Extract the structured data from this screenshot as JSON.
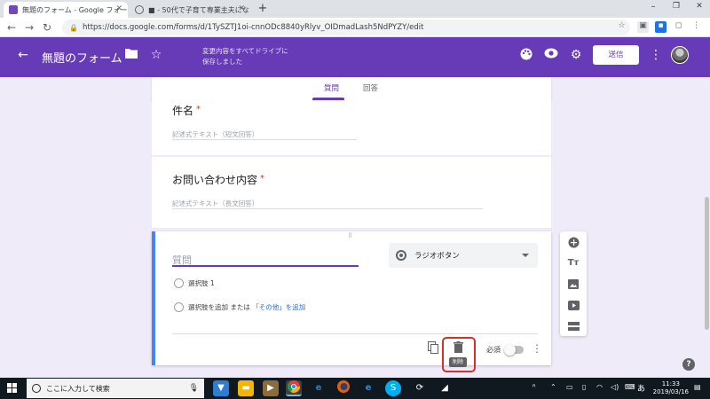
{
  "browser": {
    "tabs": [
      {
        "title": "無題のフォーム - Google フォーム",
        "active": true
      },
      {
        "title": "■ - 50代で子育て専業主夫になっ…",
        "active": false
      }
    ],
    "new_tab": "+",
    "url": "https://docs.google.com/forms/d/1TySZTJ1oi-cnnODc8840yRlyv_OIDmadLash5NdPYZY/edit",
    "window_controls": {
      "minimize": "–",
      "maximize": "❐",
      "close": "✕"
    }
  },
  "forms_header": {
    "title": "無題のフォーム",
    "save_status": "変更内容をすべてドライブに保存しました",
    "send_label": "送信",
    "brand_color": "#673ab7"
  },
  "form_tabs": [
    {
      "label": "質問",
      "active": true
    },
    {
      "label": "回答",
      "active": false
    }
  ],
  "questions": [
    {
      "title": "件名",
      "required_mark": "*",
      "hint": "記述式テキスト（短文回答）"
    },
    {
      "title": "お問い合わせ内容",
      "required_mark": "*",
      "hint": "記述式テキスト（長文回答）"
    }
  ],
  "active_question": {
    "drag_handle": "⠿",
    "placeholder": "質問",
    "type": "ラジオボタン",
    "options": [
      {
        "label": "選択肢 1"
      }
    ],
    "add_option": "選択肢を追加",
    "or_text": "または",
    "add_other": "「その他」を追加",
    "delete_tooltip": "削除",
    "required_label": "必須",
    "required_on": false
  },
  "side_toolbar": [
    "add-question-icon",
    "add-title-icon",
    "add-image-icon",
    "add-video-icon",
    "add-section-icon"
  ],
  "help": "?",
  "taskbar": {
    "search_placeholder": "ここに入力して検索",
    "ime": "あ",
    "time": "11:33",
    "date": "2019/03/16"
  }
}
